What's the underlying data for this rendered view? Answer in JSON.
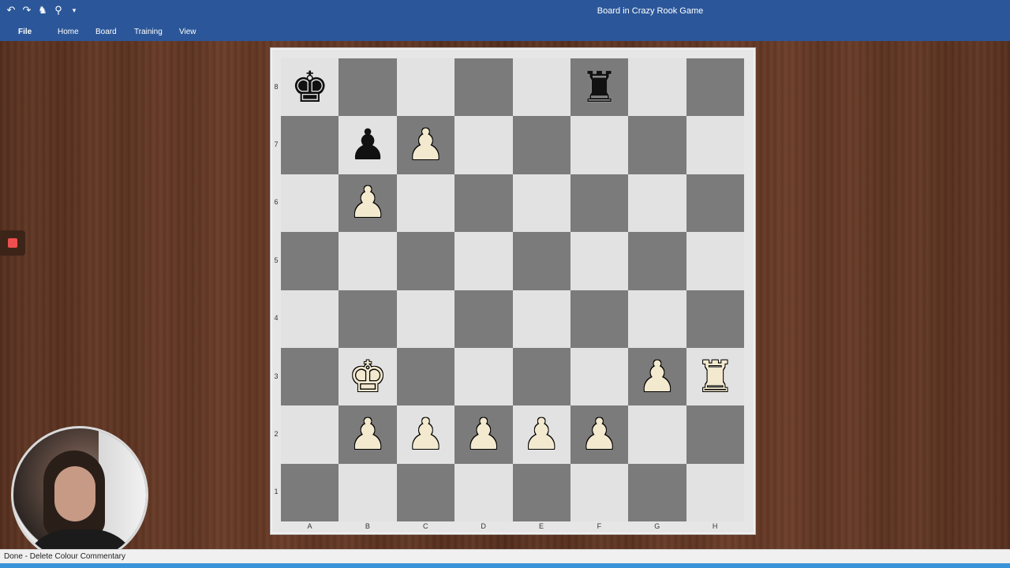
{
  "window": {
    "title": "Board in Crazy Rook Game"
  },
  "quick_access": [
    {
      "icon": "undo-icon",
      "glyph": "↶"
    },
    {
      "icon": "redo-icon",
      "glyph": "↷"
    },
    {
      "icon": "fritz-logo-icon",
      "glyph": "♞"
    },
    {
      "icon": "pin-icon",
      "glyph": "⚲"
    },
    {
      "icon": "customize-dropdown-icon",
      "glyph": "▾"
    }
  ],
  "ribbon": {
    "tabs": [
      {
        "id": "file",
        "label": "File"
      },
      {
        "id": "home",
        "label": "Home"
      },
      {
        "id": "board",
        "label": "Board"
      },
      {
        "id": "training",
        "label": "Training"
      },
      {
        "id": "view",
        "label": "View"
      }
    ]
  },
  "board": {
    "files": [
      "A",
      "B",
      "C",
      "D",
      "E",
      "F",
      "G",
      "H"
    ],
    "ranks": [
      "8",
      "7",
      "6",
      "5",
      "4",
      "3",
      "2",
      "1"
    ],
    "pieces": {
      "a8": "♚b",
      "f8": "♜b",
      "b7": "♟b",
      "c7": "♟w",
      "b6": "♟w",
      "b3": "♚w",
      "g3": "♟w",
      "h3": "♜w",
      "b2": "♟w",
      "c2": "♟w",
      "d2": "♟w",
      "e2": "♟w",
      "f2": "♟w"
    },
    "colors": {
      "light": "#e2e2e2",
      "dark": "#7b7b7b"
    }
  },
  "status": {
    "text": "Done - Delete Colour Commentary"
  },
  "colors": {
    "titlebar": "#2b579a",
    "accent": "#3a93d8",
    "record": "#ef4e4e"
  }
}
